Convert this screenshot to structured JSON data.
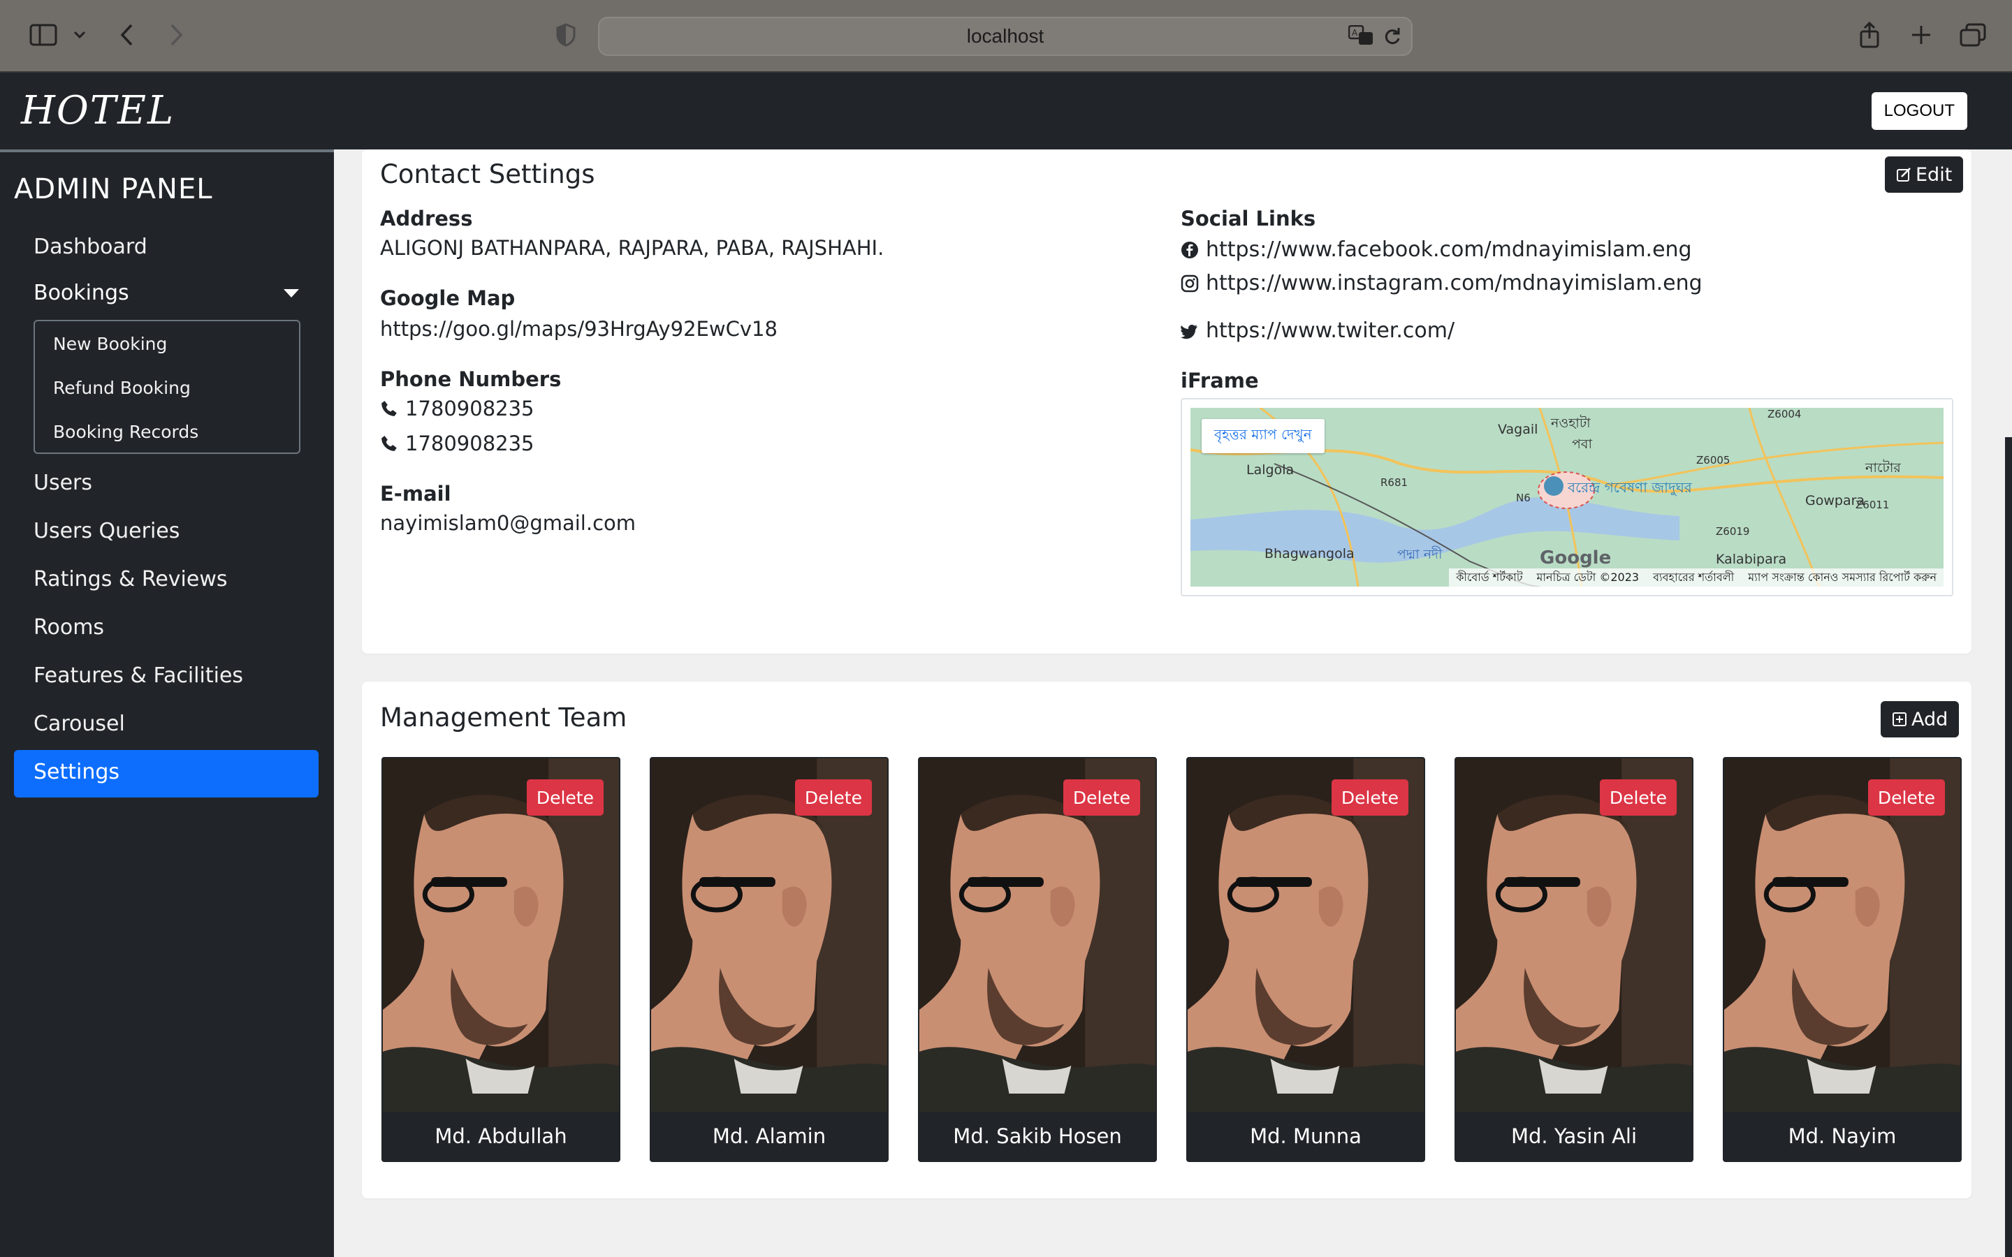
{
  "browser": {
    "url": "localhost"
  },
  "header": {
    "brand": "HOTEL",
    "logout_label": "LOGOUT"
  },
  "sidebar": {
    "title": "ADMIN PANEL",
    "dashboard": "Dashboard",
    "bookings": "Bookings",
    "booking_subitems": [
      "New Booking",
      "Refund Booking",
      "Booking Records"
    ],
    "users": "Users",
    "users_queries": "Users Queries",
    "ratings": "Ratings & Reviews",
    "rooms": "Rooms",
    "features": "Features & Facilities",
    "carousel": "Carousel",
    "settings": "Settings",
    "active_color": "#0d6efd"
  },
  "contact": {
    "title": "Contact Settings",
    "edit_label": "Edit",
    "address_label": "Address",
    "address": "ALIGONJ BATHANPARA, RAJPARA, PABA, RAJSHAHI.",
    "map_label": "Google Map",
    "map_link": "https://goo.gl/maps/93HrgAy92EwCv18",
    "phones_label": "Phone Numbers",
    "phone1": "1780908235",
    "phone2": "1780908235",
    "email_label": "E-mail",
    "email": "nayimislam0@gmail.com",
    "social_label": "Social Links",
    "facebook": "https://www.facebook.com/mdnayimislam.eng",
    "instagram": "https://www.instagram.com/mdnayimislam.eng",
    "twitter": "https://www.twiter.com/",
    "iframe_label": "iFrame",
    "iframe_map": {
      "view_larger": "বৃহত্তর ম্যাপ দেখুন",
      "places": [
        "Vagail",
        "Lalgola",
        "Gowpara",
        "Bhagwangola",
        "Kalabipara",
        "নওহাটা",
        "পবা",
        "নাটোর",
        "বরেন্দ্র গবেষণা জাদুঘর",
        "পদ্মা নদী"
      ],
      "roads": [
        "R681",
        "N6",
        "Z6004",
        "Z6005",
        "Z6011",
        "Z6019"
      ],
      "google": "Google",
      "footer": [
        "কীবোর্ড শর্টকাট",
        "মানচিত্র ডেটা ©2023",
        "ব্যবহারের শর্তাবলী",
        "ম্যাপ সংক্রান্ত কোনও সমস্যার রিপোর্ট করুন"
      ]
    }
  },
  "team": {
    "title": "Management Team",
    "add_label": "Add",
    "delete_label": "Delete",
    "members": [
      "Md. Abdullah",
      "Md. Alamin",
      "Md. Sakib Hosen",
      "Md. Munna",
      "Md. Yasin Ali",
      "Md. Nayim"
    ]
  }
}
